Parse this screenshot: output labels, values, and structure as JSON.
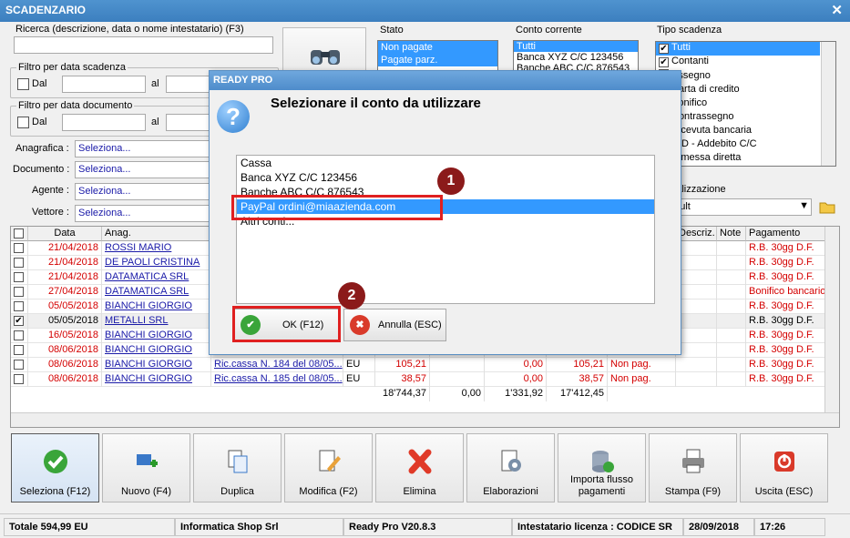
{
  "window": {
    "title": "SCADENZARIO",
    "close_glyph": "✕"
  },
  "search": {
    "label": "Ricerca (descrizione, data o nome intestatario) (F3)",
    "value": ""
  },
  "filtro_scadenza": {
    "title": "Filtro per data scadenza",
    "dal": "Dal",
    "al": "al"
  },
  "filtro_documento": {
    "title": "Filtro per data documento",
    "dal": "Dal",
    "al": "al"
  },
  "filters": [
    {
      "label": "Anagrafica :",
      "value": "Seleziona..."
    },
    {
      "label": "Documento :",
      "value": "Seleziona..."
    },
    {
      "label": "Agente :",
      "value": "Seleziona..."
    },
    {
      "label": "Vettore :",
      "value": "Seleziona..."
    }
  ],
  "stato": {
    "title": "Stato",
    "items": [
      "Non pagate",
      "Pagate parz."
    ]
  },
  "conto": {
    "title": "Conto corrente",
    "items": [
      "Tutti",
      "Banca XYZ C/C 123456",
      "Banche ABC C/C 876543"
    ]
  },
  "tipo": {
    "title": "Tipo scadenza",
    "items": [
      "Tutti",
      "Contanti",
      "Assegno",
      "Carta di credito",
      "Bonifico",
      "Contrassegno",
      "Ricevuta bancaria",
      "RID - Addebito C/C",
      "Rimessa diretta"
    ]
  },
  "visualizzazione": {
    "title": "Visualizzazione",
    "value": "Default"
  },
  "grid": {
    "headers": [
      "",
      "Data",
      "Anag.",
      "",
      "",
      "",
      "",
      "",
      "Descriz.",
      "Note",
      "Pagamento"
    ],
    "rows": [
      {
        "checked": false,
        "data": "21/04/2018",
        "anag": "ROSSI MARIO",
        "doc": "",
        "val": "",
        "imp": "",
        "pag": "",
        "res": "",
        "stato": "",
        "pagamento": "R.B. 30gg D.F.",
        "red": true
      },
      {
        "checked": false,
        "data": "21/04/2018",
        "anag": "DE PAOLI CRISTINA",
        "doc": "",
        "val": "",
        "imp": "",
        "pag": "",
        "res": "",
        "stato": "",
        "pagamento": "R.B. 30gg D.F.",
        "red": true
      },
      {
        "checked": false,
        "data": "21/04/2018",
        "anag": "DATAMATICA SRL",
        "doc": "",
        "val": "",
        "imp": "",
        "pag": "",
        "res": "",
        "stato": "",
        "pagamento": "R.B. 30gg D.F.",
        "red": true
      },
      {
        "checked": false,
        "data": "27/04/2018",
        "anag": "DATAMATICA SRL",
        "doc": "",
        "val": "",
        "imp": "",
        "pag": "",
        "res": "",
        "stato": "",
        "pagamento": "Bonifico bancario.",
        "red": true
      },
      {
        "checked": false,
        "data": "05/05/2018",
        "anag": "BIANCHI GIORGIO",
        "doc": "",
        "val": "",
        "imp": "",
        "pag": "",
        "res": "",
        "stato": "",
        "pagamento": "R.B. 30gg D.F.",
        "red": true
      },
      {
        "checked": true,
        "data": "05/05/2018",
        "anag": "METALLI SRL",
        "doc": "",
        "val": "",
        "imp": "",
        "pag": "",
        "res": "",
        "stato": "",
        "pagamento": "R.B. 30gg D.F.",
        "red": false
      },
      {
        "checked": false,
        "data": "16/05/2018",
        "anag": "BIANCHI GIORGIO",
        "doc": "",
        "val": "",
        "imp": "",
        "pag": "",
        "res": "",
        "stato": "",
        "pagamento": "R.B. 30gg D.F.",
        "red": true
      },
      {
        "checked": false,
        "data": "08/06/2018",
        "anag": "BIANCHI GIORGIO",
        "doc": "",
        "val": "",
        "imp": "",
        "pag": "",
        "res": "",
        "stato": "",
        "pagamento": "R.B. 30gg D.F.",
        "red": true
      },
      {
        "checked": false,
        "data": "08/06/2018",
        "anag": "BIANCHI GIORGIO",
        "doc": "Ric.cassa N. 184 del 08/05...",
        "val": "EU",
        "imp": "105,21",
        "pag": "0,00",
        "res": "105,21",
        "stato": "Non pag.",
        "pagamento": "R.B. 30gg D.F.",
        "red": true
      },
      {
        "checked": false,
        "data": "08/06/2018",
        "anag": "BIANCHI GIORGIO",
        "doc": "Ric.cassa N. 185 del 08/05...",
        "val": "EU",
        "imp": "38,57",
        "pag": "0,00",
        "res": "38,57",
        "stato": "Non pag.",
        "pagamento": "R.B. 30gg D.F.",
        "red": true
      }
    ],
    "totals": {
      "imp": "18'744,37",
      "x": "0,00",
      "pag": "1'331,92",
      "res": "17'412,45"
    }
  },
  "toolbar": [
    {
      "label": "Seleziona (F12)",
      "icon": "check-icon"
    },
    {
      "label": "Nuovo (F4)",
      "icon": "new-icon"
    },
    {
      "label": "Duplica",
      "icon": "duplicate-icon"
    },
    {
      "label": "Modifica (F2)",
      "icon": "edit-icon"
    },
    {
      "label": "Elimina",
      "icon": "delete-icon"
    },
    {
      "label": "Elaborazioni",
      "icon": "gear-doc-icon"
    },
    {
      "label": "Importa flusso\npagamenti",
      "icon": "database-icon"
    },
    {
      "label": "Stampa (F9)",
      "icon": "printer-icon"
    },
    {
      "label": "Uscita (ESC)",
      "icon": "exit-icon"
    }
  ],
  "status": {
    "totale": "Totale 594,99 EU",
    "company": "Informatica Shop Srl",
    "version": "Ready Pro V20.8.3",
    "licenza": "Intestatario licenza : CODICE SR",
    "date": "28/09/2018",
    "time": "17:26"
  },
  "dialog": {
    "title": "READY PRO",
    "message": "Selezionare il conto da utilizzare",
    "items": [
      "Cassa",
      "Banca XYZ C/C 123456",
      "Banche ABC C/C 876543",
      "PayPal ordini@miaazienda.com",
      "Altri conti..."
    ],
    "selected_index": 3,
    "ok_label": "OK (F12)",
    "cancel_label": "Annulla (ESC)"
  },
  "markers": {
    "one": "1",
    "two": "2"
  },
  "colors": {
    "titlebar": "#3c7fbf",
    "selection": "#3399ff",
    "annotation": "#e02020",
    "marker": "#8b1a1a",
    "overdue": "#d40000"
  }
}
